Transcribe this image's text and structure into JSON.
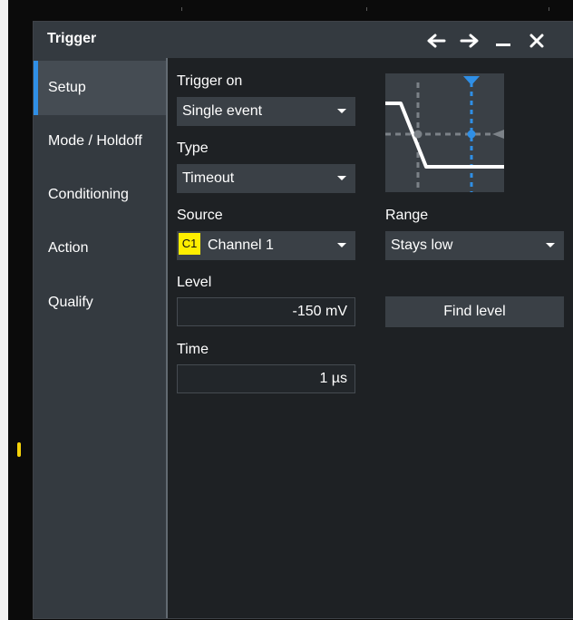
{
  "window": {
    "title": "Trigger",
    "controls": [
      "arrow-left-icon",
      "arrow-right-icon",
      "minimize-icon",
      "close-icon"
    ]
  },
  "sidebar": {
    "items": [
      {
        "label": "Setup",
        "active": true
      },
      {
        "label": "Mode / Holdoff",
        "active": false
      },
      {
        "label": "Conditioning",
        "active": false
      },
      {
        "label": "Action",
        "active": false
      },
      {
        "label": "Qualify",
        "active": false
      }
    ]
  },
  "setup": {
    "trigger_on": {
      "label": "Trigger on",
      "value": "Single event"
    },
    "type": {
      "label": "Type",
      "value": "Timeout"
    },
    "source": {
      "label": "Source",
      "badge": "C1",
      "value": "Channel 1"
    },
    "range": {
      "label": "Range",
      "value": "Stays low"
    },
    "level": {
      "label": "Level",
      "value": "-150 mV"
    },
    "find_level": {
      "label": "Find level"
    },
    "time": {
      "label": "Time",
      "value": "1 µs"
    }
  },
  "colors": {
    "accent": "#2f8fe6",
    "channel1": "#ffee00",
    "trigger_marker": "#f5d20a",
    "dialog_bg": "#1e2124",
    "panel_bg": "#343a40"
  }
}
